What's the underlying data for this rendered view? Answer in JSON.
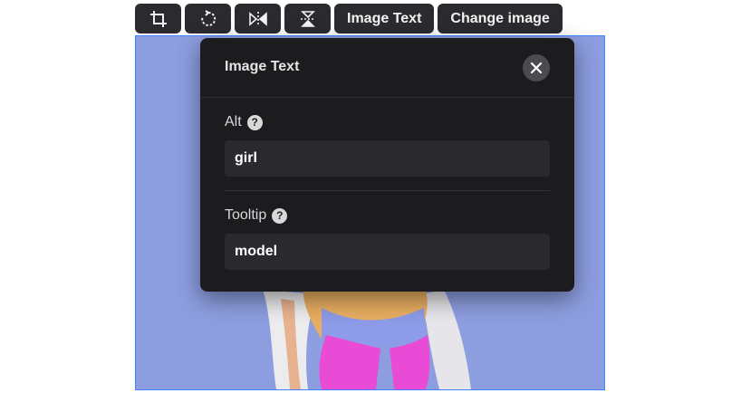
{
  "toolbar": {
    "icons": [
      "crop-icon",
      "rotate-icon",
      "flip-horizontal-icon",
      "flip-vertical-icon"
    ],
    "image_text_label": "Image Text",
    "change_image_label": "Change image"
  },
  "modal": {
    "title": "Image Text",
    "alt": {
      "label": "Alt",
      "help": "?",
      "value": "girl"
    },
    "tooltip": {
      "label": "Tooltip",
      "help": "?",
      "value": "model"
    }
  },
  "colors": {
    "toolbar_bg": "#2b2b2f",
    "modal_bg": "#1c1c1e",
    "field_bg": "#2a2a2e",
    "selection_border": "#3d86ff",
    "image_bg": "#8d9ee0"
  }
}
